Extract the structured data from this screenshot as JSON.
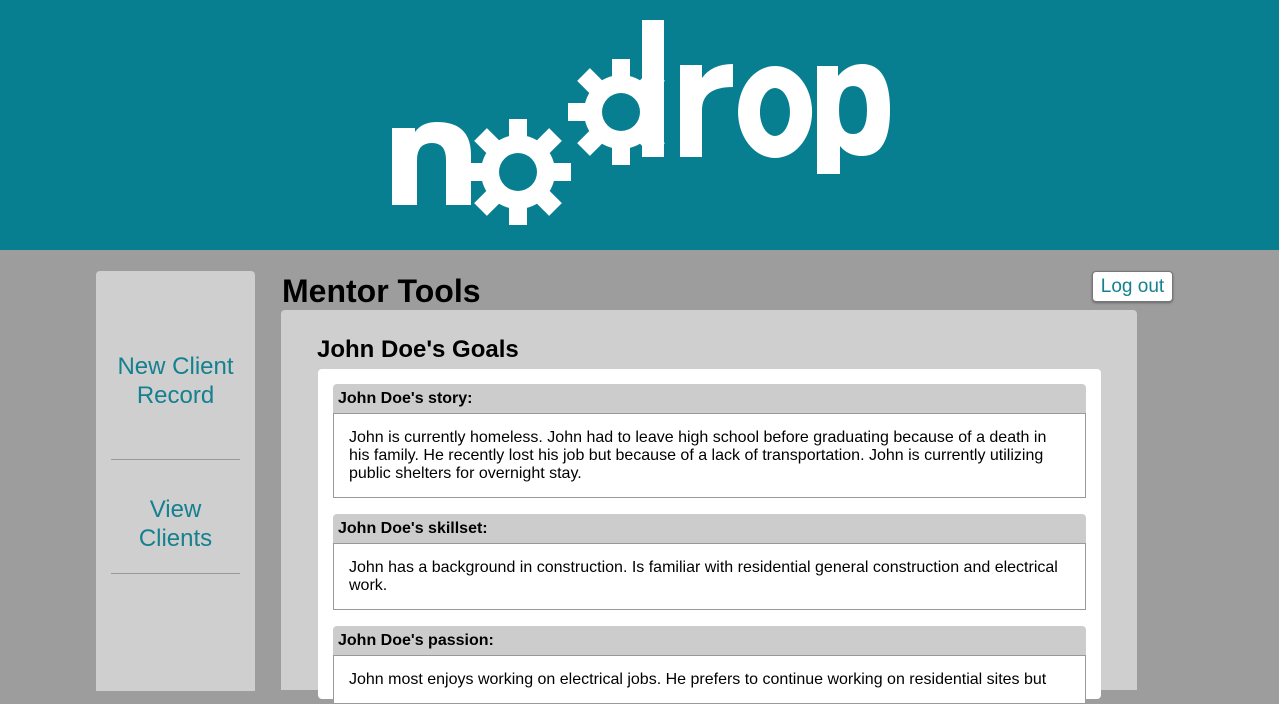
{
  "logo": {
    "text": "nodrop"
  },
  "sidebar": {
    "items": [
      {
        "label": "New Client Record"
      },
      {
        "label": "View Clients"
      }
    ]
  },
  "header": {
    "title": "Mentor Tools",
    "logout_label": "Log out"
  },
  "goals": {
    "title": "John Doe's Goals",
    "sections": [
      {
        "heading": "John Doe's story:",
        "text": "John is currently homeless. John had to leave high school before graduating because of a death in his family. He recently lost his job but because of a lack of transportation. John is currently utilizing public shelters for overnight stay."
      },
      {
        "heading": "John Doe's skillset:",
        "text": "John has a background in construction. Is familiar with residential general construction and electrical work."
      },
      {
        "heading": "John Doe's passion:",
        "text": "John most enjoys working on electrical jobs. He prefers to continue working on residential sites but"
      }
    ]
  },
  "colors": {
    "brand": "#087f91",
    "link": "#15808f",
    "page_background": "#9d9d9d",
    "panel": "#cfcfcf"
  }
}
